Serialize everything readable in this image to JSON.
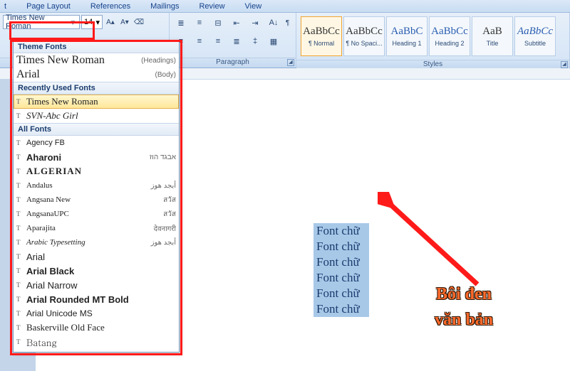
{
  "menu": {
    "items": [
      "t",
      "Page Layout",
      "References",
      "Mailings",
      "Review",
      "View"
    ]
  },
  "font": {
    "name": "Times New Roman",
    "size": "14"
  },
  "ribbon_groups": {
    "paragraph": "Paragraph",
    "styles": "Styles"
  },
  "styles": [
    {
      "prev": "AaBbCc",
      "name": "¶ Normal",
      "cls": ""
    },
    {
      "prev": "AaBbCc",
      "name": "¶ No Spaci...",
      "cls": ""
    },
    {
      "prev": "AaBbC",
      "name": "Heading 1",
      "cls": "blue"
    },
    {
      "prev": "AaBbCc",
      "name": "Heading 2",
      "cls": "blue"
    },
    {
      "prev": "AaB",
      "name": "Title",
      "cls": ""
    },
    {
      "prev": "AaBbCc",
      "name": "Subtitle",
      "cls": "blue italic"
    }
  ],
  "dropdown": {
    "h_theme": "Theme Fonts",
    "h_recent": "Recently Used Fonts",
    "h_all": "All Fonts",
    "theme": [
      {
        "name": "Times New Roman",
        "note": "(Headings)"
      },
      {
        "name": "Arial",
        "note": "(Body)"
      }
    ],
    "recent": [
      {
        "name": "Times New Roman",
        "style": ""
      },
      {
        "name": "SVN-Abc Girl",
        "style": "font-style:italic;font-family:cursive"
      }
    ],
    "all": [
      {
        "name": "Agency FB",
        "style": "font-family:Arial Narrow,sans-serif;font-size:11px"
      },
      {
        "name": "Aharoni",
        "style": "font-weight:bold;font-family:Arial,sans-serif",
        "sample": "אבגד הוז"
      },
      {
        "name": "ALGERIAN",
        "style": "font-weight:bold;letter-spacing:1px;font-family:serif"
      },
      {
        "name": "Andalus",
        "style": "font-size:11px",
        "sample": "أبجد هوز"
      },
      {
        "name": "Angsana New",
        "style": "font-size:11px",
        "sample": "สวัส"
      },
      {
        "name": "AngsanaUPC",
        "style": "font-size:11px",
        "sample": "สวัส"
      },
      {
        "name": "Aparajita",
        "style": "font-size:11px",
        "sample": "देवनागरी"
      },
      {
        "name": "Arabic Typesetting",
        "style": "font-size:11px;font-style:italic",
        "sample": "أبجد هوز"
      },
      {
        "name": "Arial",
        "style": "font-family:Arial,sans-serif"
      },
      {
        "name": "Arial Black",
        "style": "font-family:Arial Black,Arial,sans-serif;font-weight:900"
      },
      {
        "name": "Arial Narrow",
        "style": "font-family:Arial Narrow,Arial,sans-serif"
      },
      {
        "name": "Arial Rounded MT Bold",
        "style": "font-family:Arial,sans-serif;font-weight:bold"
      },
      {
        "name": "Arial Unicode MS",
        "style": "font-family:Arial,sans-serif;font-size:12px"
      },
      {
        "name": "Baskerville Old Face",
        "style": "font-family:Baskerville,serif"
      },
      {
        "name": "Batang",
        "style": "font-family:Batang,serif"
      }
    ]
  },
  "doc": {
    "line": "Font chữ",
    "repeat": 6
  },
  "annotation": {
    "l1": "Bôi đen",
    "l2": "văn bản"
  }
}
